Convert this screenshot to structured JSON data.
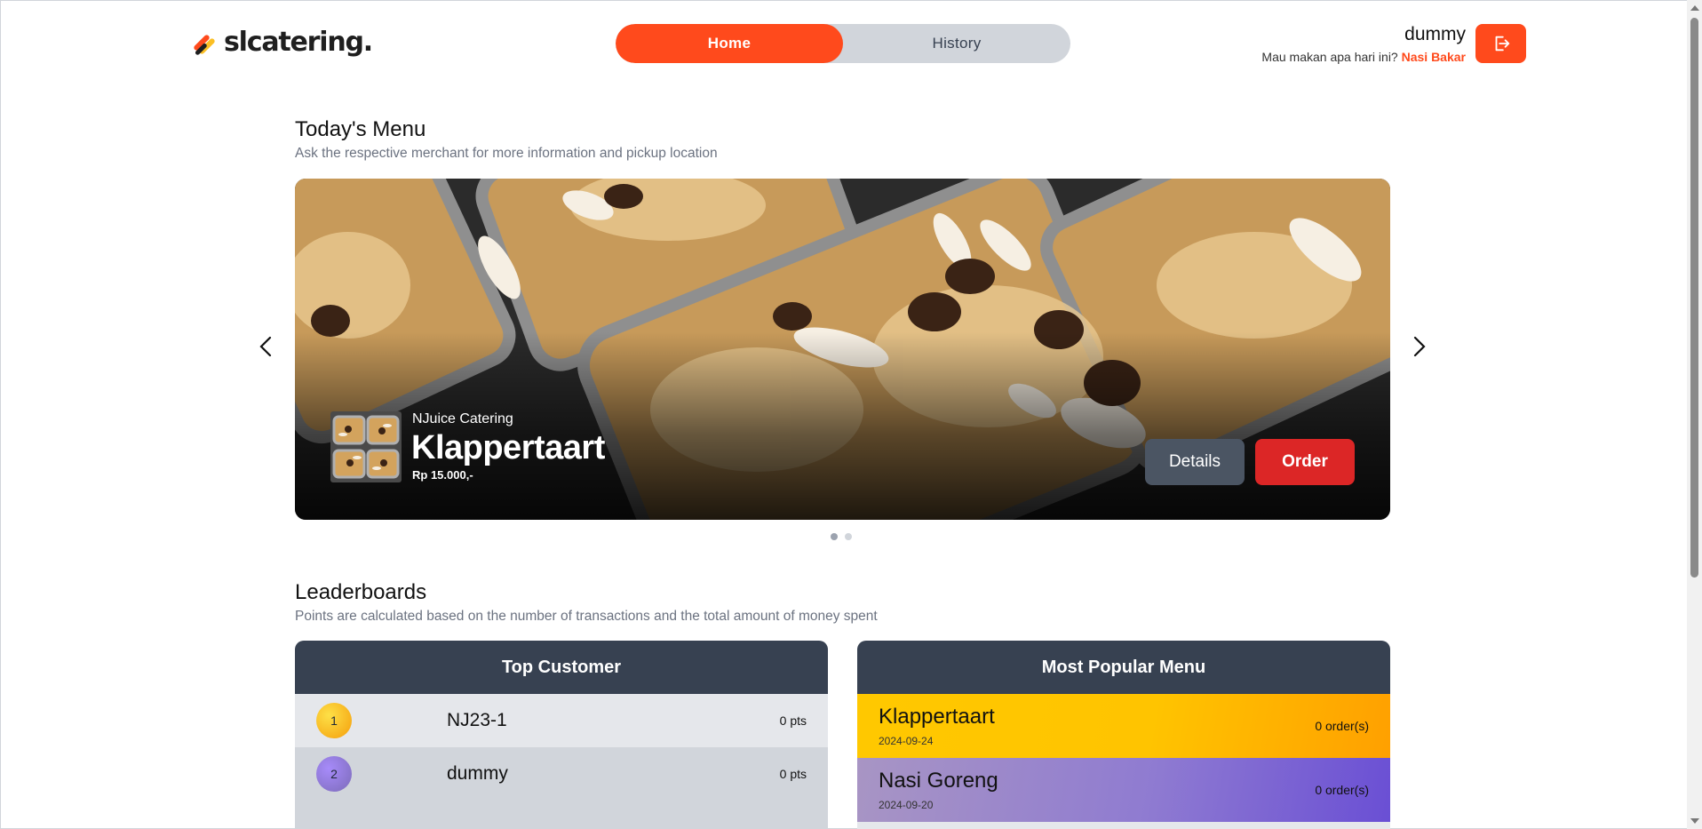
{
  "brand": {
    "name": "slcatering."
  },
  "nav": {
    "tabs": [
      {
        "label": "Home",
        "active": true
      },
      {
        "label": "History",
        "active": false
      }
    ]
  },
  "user": {
    "name": "dummy",
    "prompt": "Mau makan apa hari ini?",
    "suggestion": "Nasi Bakar"
  },
  "todays_menu": {
    "title": "Today's Menu",
    "subtitle": "Ask the respective merchant for more information and pickup location",
    "slide": {
      "merchant": "NJuice Catering",
      "name": "Klappertaart",
      "price": "Rp 15.000,-",
      "details_label": "Details",
      "order_label": "Order"
    },
    "dots": [
      {
        "active": true
      },
      {
        "active": false
      }
    ]
  },
  "leaderboards": {
    "title": "Leaderboards",
    "subtitle": "Points are calculated based on the number of transactions and the total amount of money spent",
    "top_customer": {
      "title": "Top Customer",
      "rows": [
        {
          "rank": "1",
          "name": "NJ23-1",
          "points": "0 pts"
        },
        {
          "rank": "2",
          "name": "dummy",
          "points": "0 pts"
        }
      ]
    },
    "popular_menu": {
      "title": "Most Popular Menu",
      "rows": [
        {
          "name": "Klappertaart",
          "date": "2024-09-24",
          "orders": "0 order(s)"
        },
        {
          "name": "Nasi Goreng",
          "date": "2024-09-20",
          "orders": "0 order(s)"
        }
      ]
    }
  },
  "colors": {
    "accent": "#ff4a1c",
    "order": "#dc2626",
    "panel_header": "#374151",
    "gold": "#fbbf24",
    "purple": "#8b7bd0"
  },
  "icons": {
    "logout": "logout-icon",
    "prev": "chevron-left-icon",
    "next": "chevron-right-icon",
    "logo": "logo-icon"
  }
}
